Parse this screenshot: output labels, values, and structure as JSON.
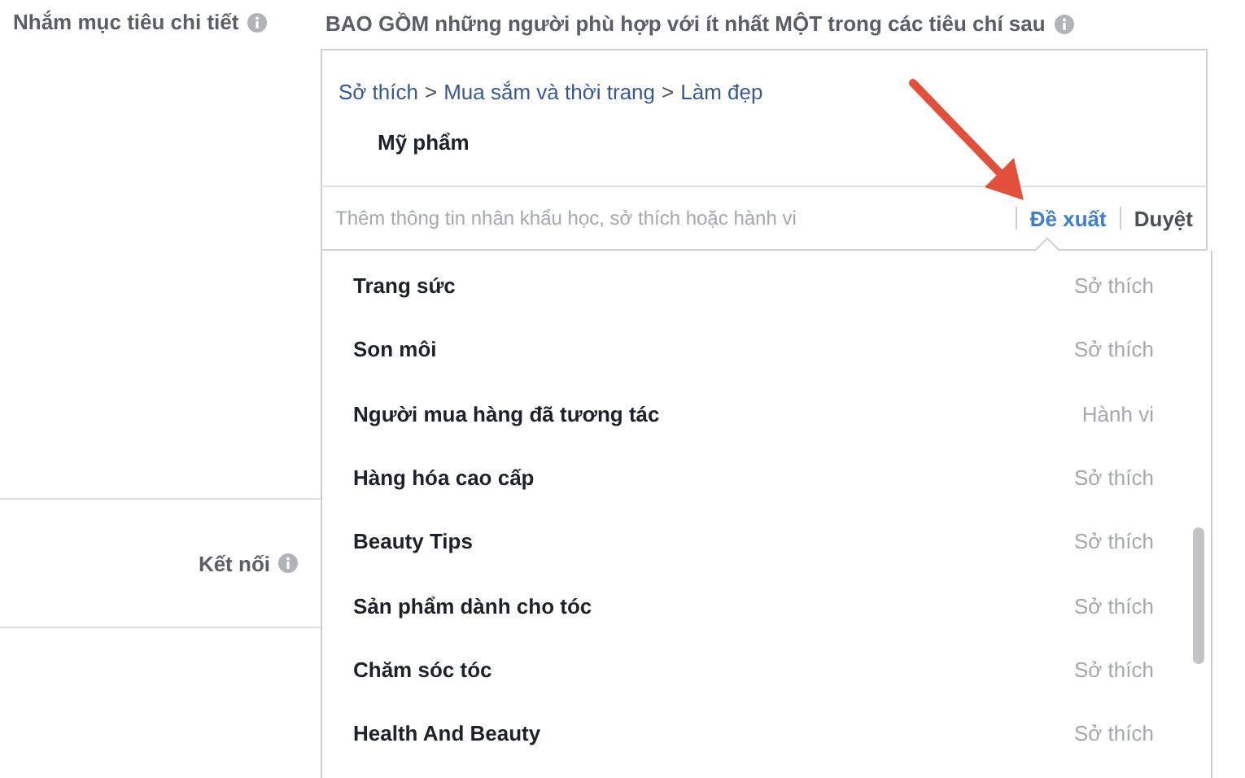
{
  "detailed_targeting": {
    "label": "Nhắm mục tiêu chi tiết",
    "heading": "BAO GỒM những người phù hợp với ít nhất MỘT trong các tiêu chí sau"
  },
  "selected_path": {
    "breadcrumb": [
      {
        "label": "Sở thích"
      },
      {
        "label": "Mua sắm và thời trang"
      },
      {
        "label": "Làm đẹp"
      }
    ],
    "separator": ">",
    "item": "Mỹ phẩm"
  },
  "search": {
    "placeholder": "Thêm thông tin nhân khẩu học, sở thích hoặc hành vi"
  },
  "tabs": [
    {
      "label": "Đề xuất",
      "selected": true
    },
    {
      "label": "Duyệt",
      "selected": false
    }
  ],
  "suggestions": [
    {
      "name": "Trang sức",
      "type": "Sở thích"
    },
    {
      "name": "Son môi",
      "type": "Sở thích"
    },
    {
      "name": "Người mua hàng đã tương tác",
      "type": "Hành vi"
    },
    {
      "name": "Hàng hóa cao cấp",
      "type": "Sở thích"
    },
    {
      "name": "Beauty Tips",
      "type": "Sở thích"
    },
    {
      "name": "Sản phẩm dành cho tóc",
      "type": "Sở thích"
    },
    {
      "name": "Chăm sóc tóc",
      "type": "Sở thích"
    },
    {
      "name": "Health And Beauty",
      "type": "Sở thích"
    }
  ],
  "connections": {
    "label": "Kết nối"
  }
}
